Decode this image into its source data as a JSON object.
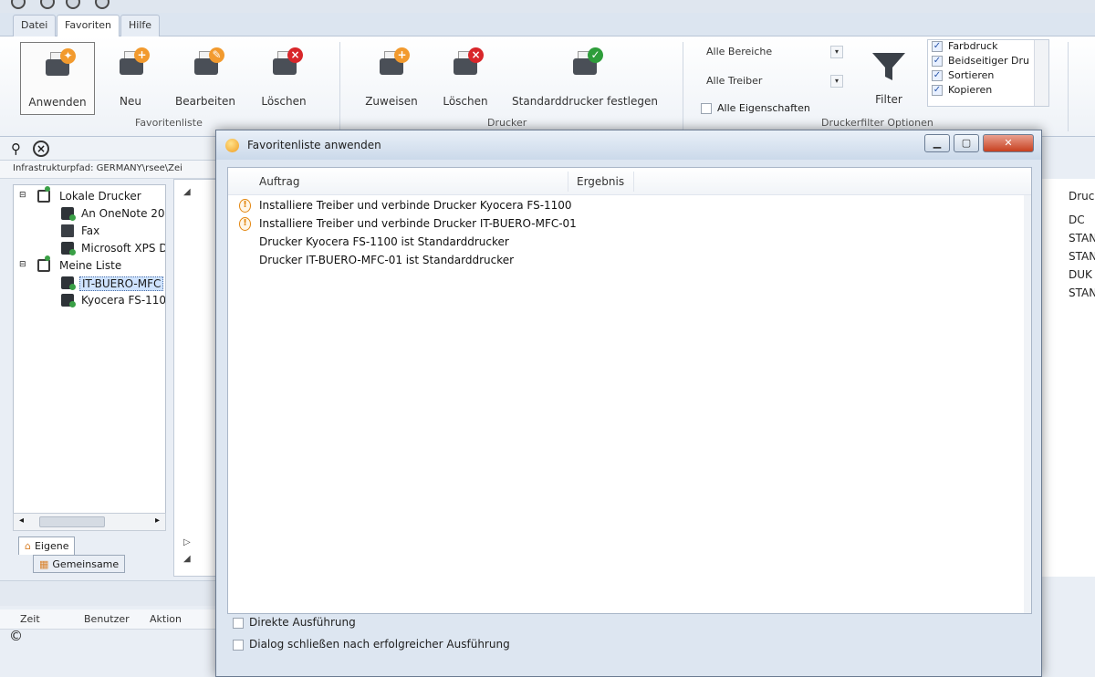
{
  "menu_tabs": [
    "Datei",
    "Favoriten",
    "Hilfe"
  ],
  "ribbon": {
    "favoritenliste": {
      "group_label": "Favoritenliste",
      "buttons": [
        "Anwenden",
        "Neu",
        "Bearbeiten",
        "Löschen"
      ]
    },
    "drucker": {
      "group_label": "Drucker",
      "buttons": [
        "Zuweisen",
        "Löschen",
        "Standarddrucker festlegen"
      ]
    },
    "filter": {
      "group_label": "Druckerfilter Optionen",
      "combo_bereiche": "Alle Bereiche",
      "combo_treiber": "Alle Treiber",
      "alle_eigenschaften": "Alle Eigenschaften",
      "filter_button": "Filter",
      "options": [
        "Farbdruck",
        "Beidseitiger Dru",
        "Sortieren",
        "Kopieren"
      ]
    }
  },
  "path_text": "Infrastrukturpfad: GERMANY\\rsee\\Zei",
  "tree": {
    "lokale_drucker": "Lokale Drucker",
    "lokal_items": [
      "An OneNote 20",
      "Fax",
      "Microsoft XPS D"
    ],
    "meine_liste": "Meine Liste",
    "meine_items": [
      "IT-BUERO-MFC",
      "Kyocera FS-110"
    ]
  },
  "left_tabs": [
    "Eigene",
    "Gemeinsame"
  ],
  "log_columns": [
    "Zeit",
    "Benutzer",
    "Aktion"
  ],
  "right_partial": [
    "Druck",
    "DC",
    "STAN",
    "STAN",
    "DUK",
    "STAN"
  ],
  "dialog": {
    "title": "Favoritenliste anwenden",
    "columns": [
      "Auftrag",
      "Ergebnis"
    ],
    "rows": [
      "Installiere Treiber und verbinde Drucker Kyocera FS-1100",
      "Installiere Treiber und verbinde Drucker IT-BUERO-MFC-01",
      "Drucker Kyocera FS-1100 ist Standarddrucker",
      "Drucker IT-BUERO-MFC-01 ist Standarddrucker"
    ],
    "checkbox_direct": "Direkte Ausführung",
    "checkbox_close": "Dialog schließen nach erfolgreicher Ausführung"
  },
  "copyright": "©"
}
